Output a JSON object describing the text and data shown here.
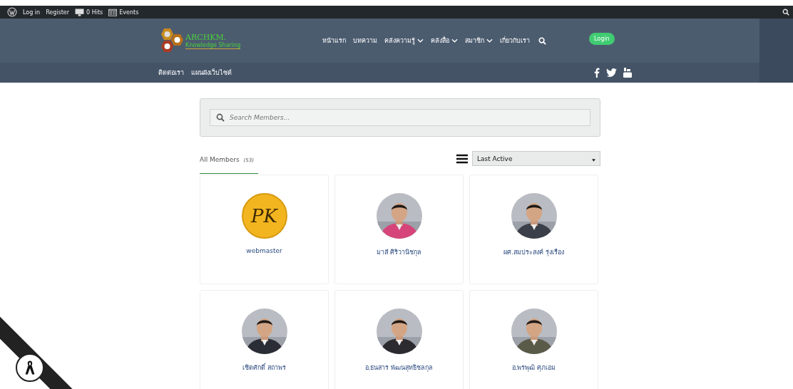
{
  "admin_bar": {
    "items": [
      {
        "kind": "logo"
      },
      {
        "kind": "link",
        "label": "Log in"
      },
      {
        "kind": "link",
        "label": "Register"
      },
      {
        "kind": "hits",
        "label": "0 Hits"
      },
      {
        "kind": "events",
        "label": "Events"
      }
    ]
  },
  "header": {
    "logo": {
      "title": "ARCHKM.",
      "subtitle": "Knowledge Sharing"
    },
    "nav": [
      {
        "label": "หน้าแรก",
        "dropdown": false
      },
      {
        "label": "บทความ",
        "dropdown": false
      },
      {
        "label": "คลังความรู้",
        "dropdown": true
      },
      {
        "label": "คลังสื่อ",
        "dropdown": true
      },
      {
        "label": "สมาชิก",
        "dropdown": true
      },
      {
        "label": "เกี่ยวกับเรา",
        "dropdown": false
      }
    ],
    "login_button": "Login",
    "sub_nav": [
      "ติดต่อเรา",
      "แผนผังเว็บไซต์"
    ]
  },
  "search": {
    "placeholder": "Search Members..."
  },
  "tabs": [
    {
      "label": "All Members",
      "count": "(53)",
      "selected": true
    }
  ],
  "sort": {
    "value": "Last Active"
  },
  "members": [
    {
      "name": "webmaster",
      "kind": "logo",
      "logo_text": "PK"
    },
    {
      "name": "มาลี ศิริวานิชกุล",
      "color": "#d6457a"
    },
    {
      "name": "ผศ.สมประสงค์ รุ่งเรือง",
      "color": "#3a3f4a"
    },
    {
      "name": "เชิดศักดิ์ สถาพร",
      "color": "#2a2d35"
    },
    {
      "name": "อ.ธนสาร พัฒนสุทธิชลกุล",
      "color": "#2b2b30"
    },
    {
      "name": "อ.พรพุฒิ ศุภเอม",
      "color": "#5a5a48"
    }
  ]
}
